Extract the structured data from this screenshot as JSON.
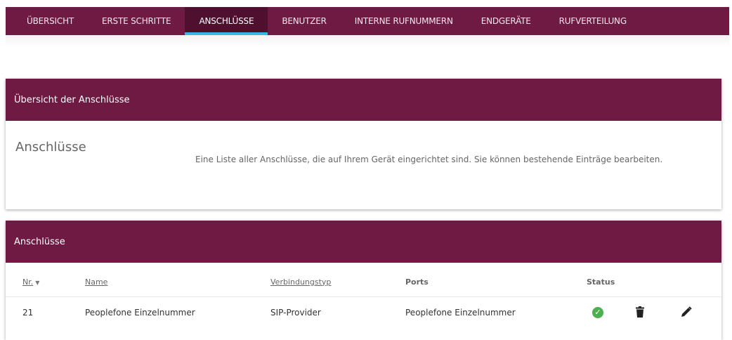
{
  "nav": {
    "tabs": [
      {
        "label": "ÜBERSICHT"
      },
      {
        "label": "ERSTE SCHRITTE"
      },
      {
        "label": "ANSCHLÜSSE"
      },
      {
        "label": "BENUTZER"
      },
      {
        "label": "INTERNE RUFNUMMERN"
      },
      {
        "label": "ENDGERÄTE"
      },
      {
        "label": "RUFVERTEILUNG"
      }
    ],
    "active_index": 2
  },
  "overview_card": {
    "header": "Übersicht der Anschlüsse",
    "title": "Anschlüsse",
    "description": "Eine Liste aller Anschlüsse, die auf Ihrem Gerät eingerichtet sind. Sie können bestehende Einträge bearbeiten."
  },
  "table_card": {
    "header": "Anschlüsse",
    "columns": {
      "nr": "Nr.",
      "name": "Name",
      "type": "Verbindungstyp",
      "ports": "Ports",
      "status": "Status"
    },
    "rows": [
      {
        "nr": "21",
        "name": "Peoplefone Einzelnummer",
        "type": "SIP-Provider",
        "ports": "Peoplefone Einzelnummer",
        "status_icon": "check-circle-icon"
      }
    ]
  },
  "colors": {
    "brand": "#6f1a43",
    "active_tab_underline": "#39b6e6",
    "status_ok": "#4caf50"
  }
}
